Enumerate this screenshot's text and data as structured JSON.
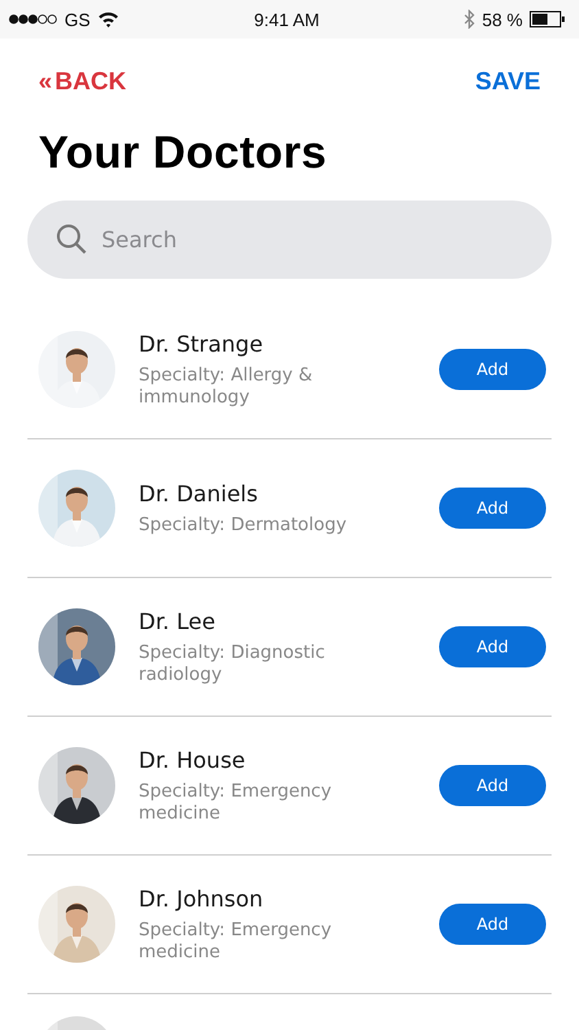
{
  "status_bar": {
    "carrier": "GS",
    "time": "9:41 AM",
    "battery_percent": "58 %"
  },
  "nav": {
    "back_icon": "«",
    "back": "BACK",
    "save": "SAVE"
  },
  "title": "Your Doctors",
  "search": {
    "placeholder": "Search"
  },
  "doctors": [
    {
      "name": "Dr. Strange",
      "specialty": "Specialty: Allergy & immunology",
      "button": "Add"
    },
    {
      "name": "Dr. Daniels",
      "specialty": "Specialty: Dermatology",
      "button": "Add"
    },
    {
      "name": "Dr. Lee",
      "specialty": "Specialty: Diagnostic radiology",
      "button": "Add"
    },
    {
      "name": "Dr. House",
      "specialty": "Specialty: Emergency medicine",
      "button": "Add"
    },
    {
      "name": "Dr. Johnson",
      "specialty": "Specialty: Emergency medicine",
      "button": "Add"
    }
  ]
}
